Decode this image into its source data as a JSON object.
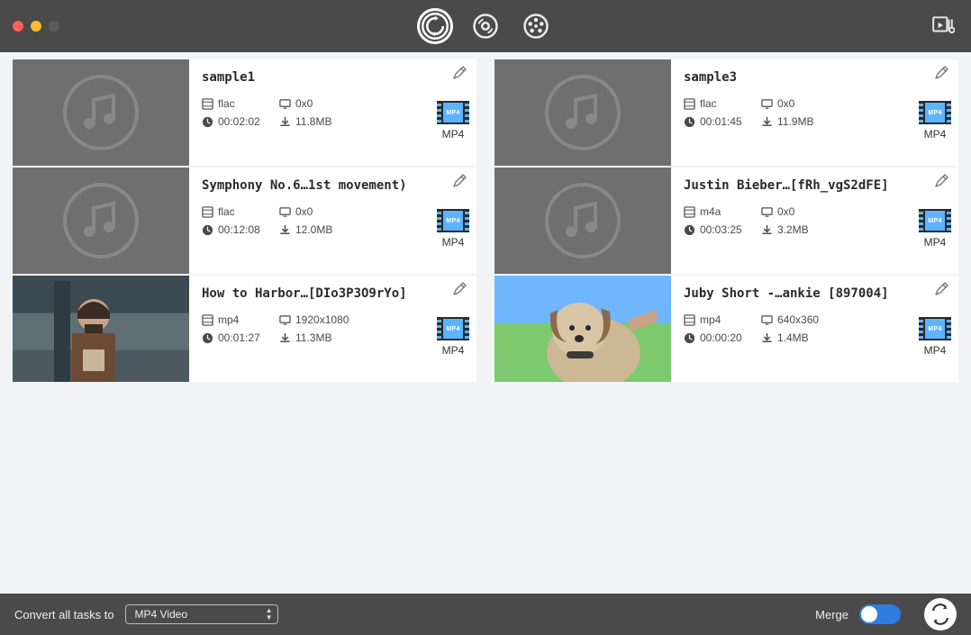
{
  "bottom": {
    "convert_label": "Convert all tasks to",
    "format_selected": "MP4 Video",
    "merge_label": "Merge",
    "merge_on": false
  },
  "items": [
    {
      "title": "sample1",
      "codec": "flac",
      "resolution": "0x0",
      "duration": "00:02:02",
      "size": "11.8MB",
      "out_format": "MP4",
      "thumb_kind": "audio"
    },
    {
      "title": "sample3",
      "codec": "flac",
      "resolution": "0x0",
      "duration": "00:01:45",
      "size": "11.9MB",
      "out_format": "MP4",
      "thumb_kind": "audio"
    },
    {
      "title": "Symphony No.6…1st movement)",
      "codec": "flac",
      "resolution": "0x0",
      "duration": "00:12:08",
      "size": "12.0MB",
      "out_format": "MP4",
      "thumb_kind": "audio"
    },
    {
      "title": "Justin Bieber…[fRh_vgS2dFE]",
      "codec": "m4a",
      "resolution": "0x0",
      "duration": "00:03:25",
      "size": "3.2MB",
      "out_format": "MP4",
      "thumb_kind": "audio"
    },
    {
      "title": "How to Harbor…[DIo3P3O9rYo]",
      "codec": "mp4",
      "resolution": "1920x1080",
      "duration": "00:01:27",
      "size": "11.3MB",
      "out_format": "MP4",
      "thumb_kind": "cartoon"
    },
    {
      "title": "Juby Short -…ankie [897004]",
      "codec": "mp4",
      "resolution": "640x360",
      "duration": "00:00:20",
      "size": "1.4MB",
      "out_format": "MP4",
      "thumb_kind": "dog"
    }
  ]
}
